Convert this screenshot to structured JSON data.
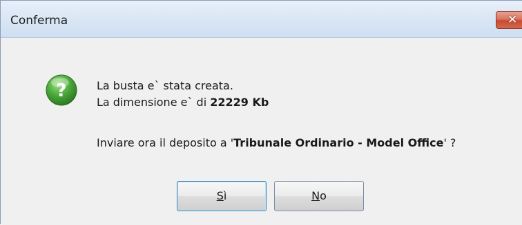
{
  "window": {
    "title": "Conferma",
    "close_glyph": "✕"
  },
  "message": {
    "line1": "La busta e` stata creata.",
    "line2_prefix": "La dimensione e` di ",
    "line2_value": "22229 Kb",
    "line3_prefix": "Inviare ora il deposito a '",
    "line3_target": "Tribunale Ordinario - Model Office",
    "line3_suffix": "' ?"
  },
  "icon": {
    "name": "question-icon",
    "glyph": "?",
    "color": "#4aa83a"
  },
  "buttons": {
    "yes_mnemonic": "S",
    "yes_rest": "ì",
    "no_mnemonic": "N",
    "no_rest": "o"
  }
}
